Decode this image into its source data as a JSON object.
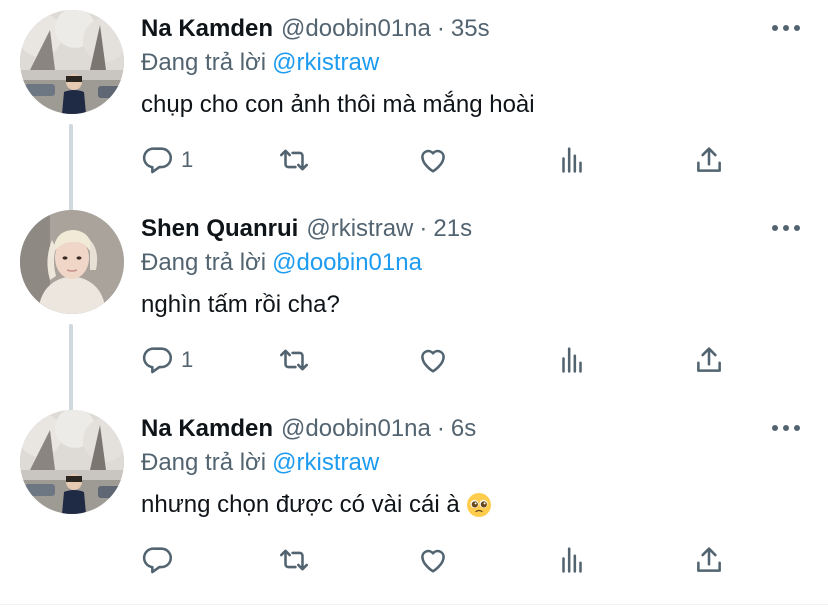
{
  "tweets": [
    {
      "name": "Na Kamden",
      "handle": "@doobin01na",
      "separator": "·",
      "time": "35s",
      "replying_prefix": "Đang trả lời",
      "replying_to": "@rkistraw",
      "text": "chụp cho con ảnh thôi mà mắng hoài",
      "reply_count": "1",
      "avatar": "cherry-blossom-photo"
    },
    {
      "name": "Shen Quanrui",
      "handle": "@rkistraw",
      "separator": "·",
      "time": "21s",
      "replying_prefix": "Đang trả lời",
      "replying_to": "@doobin01na",
      "text": "nghìn tấm rồi cha?",
      "reply_count": "1",
      "avatar": "blond-portrait-photo"
    },
    {
      "name": "Na Kamden",
      "handle": "@doobin01na",
      "separator": "·",
      "time": "6s",
      "replying_prefix": "Đang trả lời",
      "replying_to": "@rkistraw",
      "text": "nhưng chọn được có vài cái à",
      "emoji": "pleading-face-emoji",
      "reply_count": "",
      "avatar": "cherry-blossom-photo"
    }
  ],
  "icons": {
    "reply": "reply-icon",
    "retweet": "retweet-icon",
    "like": "heart-icon",
    "stats": "stats-icon",
    "share": "share-icon",
    "more": "more-icon"
  },
  "colors": {
    "text": "#0f1419",
    "secondary": "#536471",
    "link": "#1d9bf0",
    "thread_line": "#cfd9de"
  }
}
